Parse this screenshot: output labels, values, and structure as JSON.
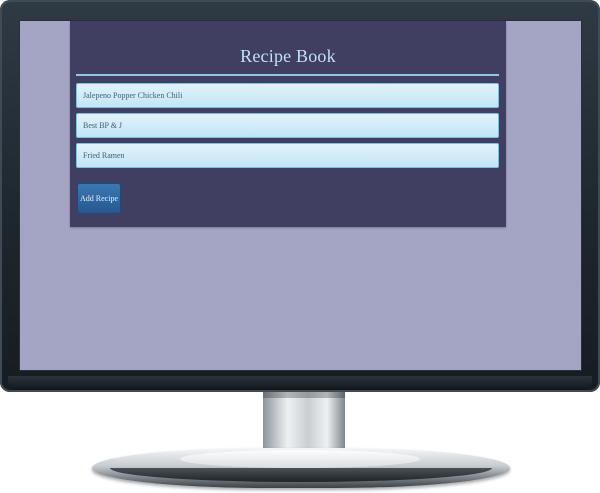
{
  "app": {
    "title": "Recipe Book",
    "add_button_label": "Add Recipe"
  },
  "recipes": [
    {
      "name": "Jalepeno Popper Chicken Chili"
    },
    {
      "name": "Best BP & J"
    },
    {
      "name": "Fried Ramen"
    }
  ],
  "colors": {
    "screen_background": "#a4a4c4",
    "panel_background": "#403f62",
    "title_color": "#bfe0f5",
    "accent_rule": "#8fc7e6",
    "list_item_background": "#d2ecf8",
    "button_background": "#2f6aa2"
  }
}
